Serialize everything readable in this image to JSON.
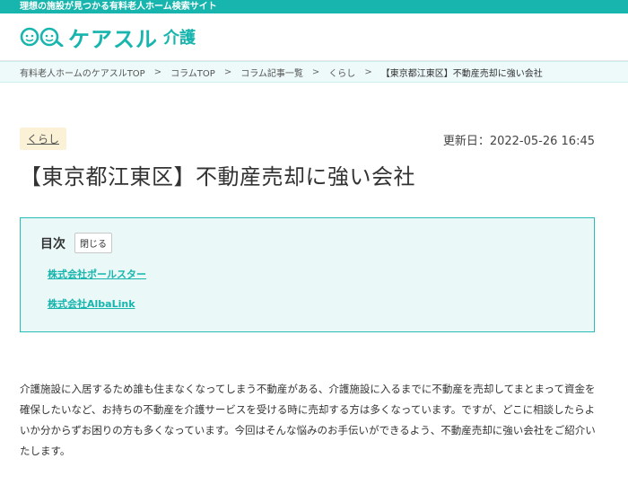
{
  "site": {
    "tagline": "理想の施設が見つかる有料老人ホーム検索サイト",
    "logo_text": "ケアスル",
    "logo_sub": "介護",
    "colors": {
      "brand": "#17b5ad",
      "toc_bg": "#eaf8f8",
      "tag_bg": "#fbf1d6"
    }
  },
  "breadcrumb": {
    "items": [
      "有料老人ホームのケアスルTOP",
      "コラムTOP",
      "コラム記事一覧",
      "くらし"
    ],
    "current": "【東京都江東区】不動産売却に強い会社",
    "separator": ">"
  },
  "article": {
    "category": "くらし",
    "updated": "更新日：2022-05-26 16:45",
    "title": "【東京都江東区】不動産売却に強い会社",
    "body": "介護施設に入居するため誰も住まなくなってしまう不動産がある、介護施設に入るまでに不動産を売却してまとまって資金を確保したいなど、お持ちの不動産を介護サービスを受ける時に売却する方は多くなっています。ですが、どこに相談したらよいか分からずお困りの方も多くなっています。今回はそんな悩みのお手伝いができるよう、不動産売却に強い会社をご紹介いたします。"
  },
  "toc": {
    "title": "目次",
    "toggle_label": "閉じる",
    "items": [
      "株式会社ポールスター",
      "株式会社AlbaLink"
    ]
  }
}
